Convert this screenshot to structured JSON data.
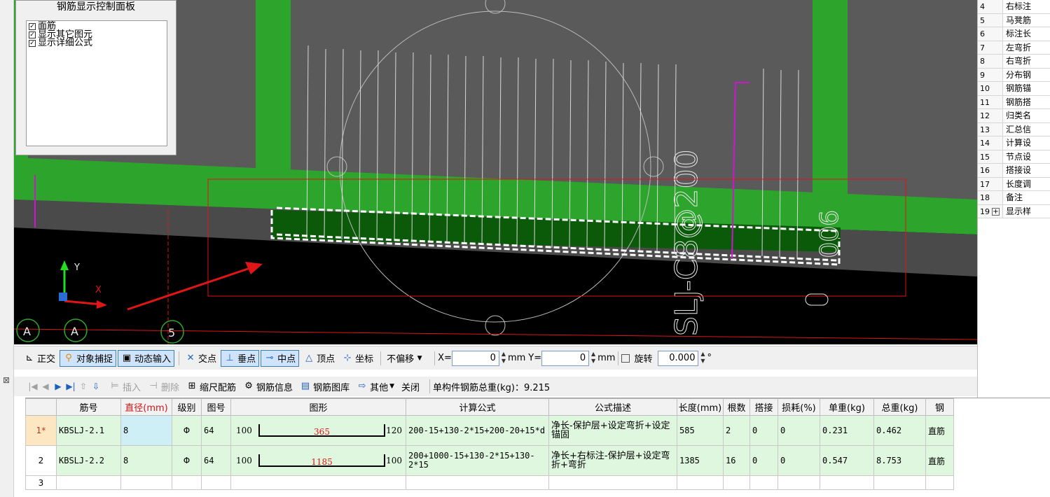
{
  "control_panel": {
    "title": "钢筋显示控制面板",
    "options": [
      {
        "label": "面筋",
        "checked": true
      },
      {
        "label": "显示其它图元",
        "checked": true
      },
      {
        "label": "显示详细公式",
        "checked": true
      }
    ]
  },
  "viewport": {
    "axis_labels": {
      "y": "Y",
      "x": "X"
    },
    "grid_bubbles": [
      "A",
      "A",
      "5"
    ],
    "rebar_text_1": "SLJ-C8@200",
    "rebar_text_2": "900",
    "colors": {
      "background": "#000000",
      "slab": "#2da52d",
      "wall_gray": "#5a5a5a",
      "highlight": "#e01515",
      "magenta": "#d015d0"
    }
  },
  "properties": {
    "rows": [
      {
        "idx": "4",
        "name": "右标注"
      },
      {
        "idx": "5",
        "name": "马凳筋"
      },
      {
        "idx": "6",
        "name": "标注长"
      },
      {
        "idx": "7",
        "name": "左弯折"
      },
      {
        "idx": "8",
        "name": "右弯折"
      },
      {
        "idx": "9",
        "name": "分布钢"
      },
      {
        "idx": "10",
        "name": "钢筋锚"
      },
      {
        "idx": "11",
        "name": "钢筋搭"
      },
      {
        "idx": "12",
        "name": "归类名"
      },
      {
        "idx": "13",
        "name": "汇总信"
      },
      {
        "idx": "14",
        "name": "计算设"
      },
      {
        "idx": "15",
        "name": "节点设"
      },
      {
        "idx": "16",
        "name": "搭接设"
      },
      {
        "idx": "17",
        "name": "长度调"
      },
      {
        "idx": "18",
        "name": "备注"
      },
      {
        "idx": "19",
        "name": "显示样"
      }
    ]
  },
  "snap_toolbar": {
    "ortho": "正交",
    "object_snap": "对象捕捉",
    "dynamic_input": "动态输入",
    "intersection": "交点",
    "perpendicular": "垂点",
    "midpoint": "中点",
    "vertex": "顶点",
    "coordinate": "坐标",
    "offset_mode": "不偏移",
    "x_label": "X=",
    "x_value": "0",
    "x_unit": "mm",
    "y_label": "Y=",
    "y_value": "0",
    "y_unit": "mm",
    "rotate_label": "旋转",
    "rotate_value": "0.000",
    "degree": "°"
  },
  "grid_toolbar": {
    "insert": "插入",
    "delete": "删除",
    "scale_rebar": "缩尺配筋",
    "rebar_info": "钢筋信息",
    "rebar_library": "钢筋图库",
    "other": "其他",
    "close": "关闭",
    "total_weight": "单构件钢筋总重(kg)：9.215"
  },
  "table": {
    "headers": [
      "",
      "筋号",
      "直径(mm)",
      "级别",
      "图号",
      "图形",
      "计算公式",
      "公式描述",
      "长度(mm)",
      "根数",
      "搭接",
      "损耗(%)",
      "单重(kg)",
      "总重(kg)",
      "钢"
    ],
    "rows": [
      {
        "idx": "1*",
        "bar_no": "KBSLJ-2.1",
        "diameter": "8",
        "grade": "Φ",
        "fig_no": "64",
        "shape_left": "100",
        "shape_mid": "365",
        "shape_right": "120",
        "formula": "200-15+130-2*15+200-20+15*d",
        "description": "净长-保护层+设定弯折+设定锚固",
        "length": "585",
        "count": "2",
        "lap": "0",
        "loss": "0",
        "unit_weight": "0.231",
        "total_weight": "0.462",
        "type": "直筋"
      },
      {
        "idx": "2",
        "bar_no": "KBSLJ-2.2",
        "diameter": "8",
        "grade": "Φ",
        "fig_no": "64",
        "shape_left": "100",
        "shape_mid": "1185",
        "shape_right": "100",
        "formula": "200+1000-15+130-2*15+130-2*15",
        "description": "净长+右标注-保护层+设定弯折+弯折",
        "length": "1385",
        "count": "16",
        "lap": "0",
        "loss": "0",
        "unit_weight": "0.547",
        "total_weight": "8.753",
        "type": "直筋"
      }
    ],
    "empty_idx": "3"
  }
}
